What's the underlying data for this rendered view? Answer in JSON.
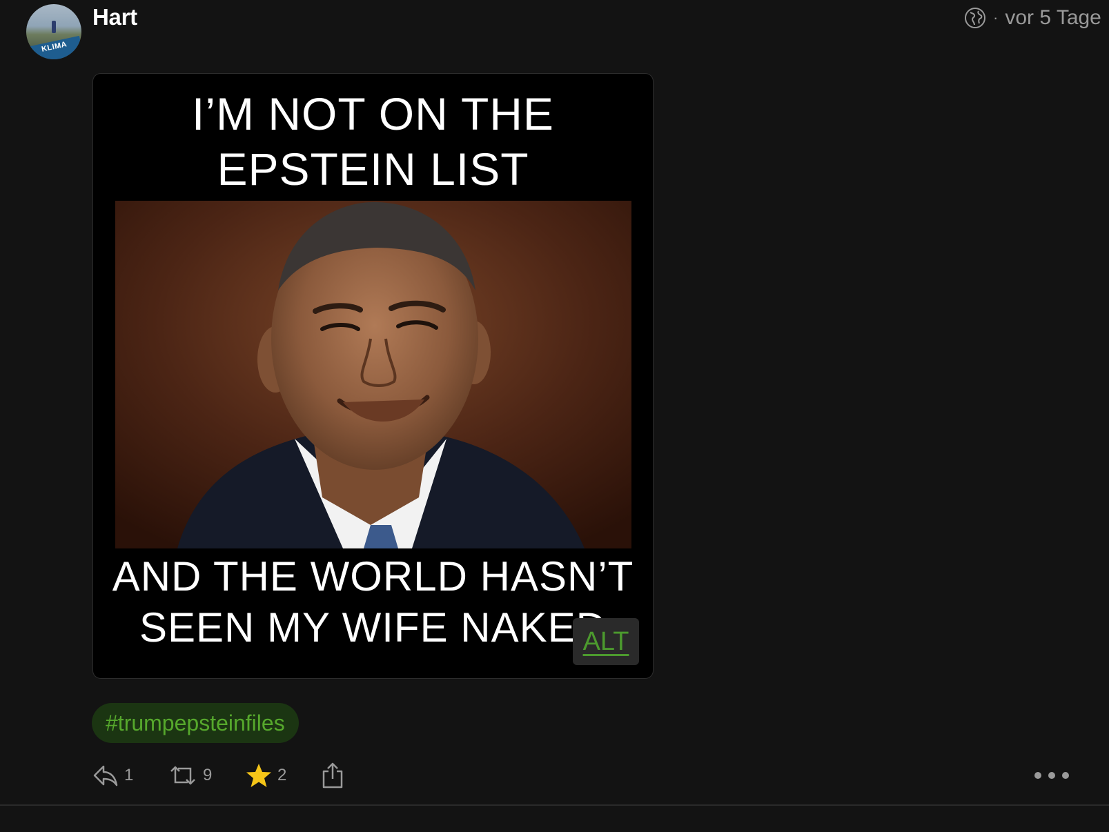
{
  "post": {
    "author": "Hart",
    "avatar_badge": "KLIMA",
    "visibility_icon": "globe-icon",
    "separator": "·",
    "timestamp": "vor 5 Tage",
    "image": {
      "top_text_line1": "I’M NOT ON THE",
      "top_text_line2": "EPSTEIN LIST",
      "bottom_text_line1": "AND THE WORLD HASN’T",
      "bottom_text_line2": "SEEN MY WIFE NAKED",
      "alt_label": "ALT"
    },
    "hashtag": "#trumpepsteinfiles",
    "actions": {
      "reply_count": "1",
      "boost_count": "9",
      "favourite_count": "2"
    }
  },
  "colors": {
    "background": "#131313",
    "accent_green": "#56a82c",
    "hashtag_bg": "#1b3512",
    "star": "#f5c518",
    "muted": "#9a9a9a"
  }
}
